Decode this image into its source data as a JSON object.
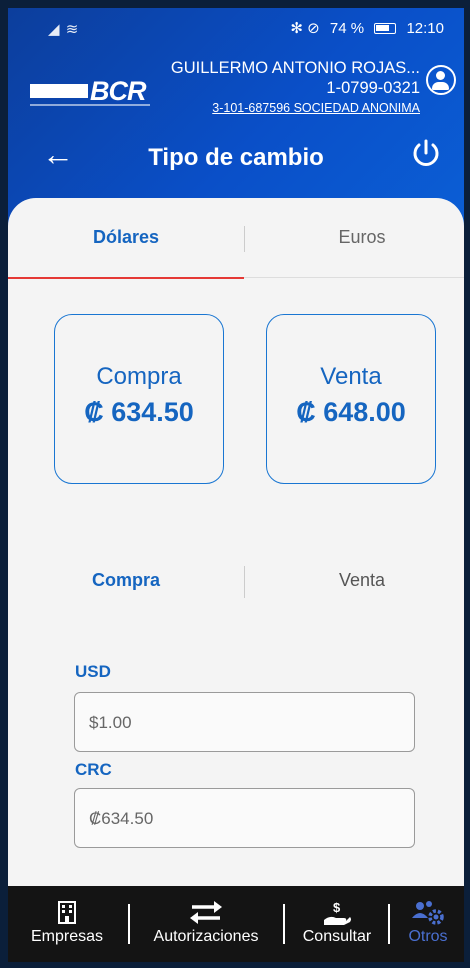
{
  "status": {
    "left": "◢ ≋",
    "right_icons": "✻ ⊘",
    "battery": "74 %",
    "time": "12:10"
  },
  "brand": {
    "logo_text": "BCR"
  },
  "user": {
    "name": "GUILLERMO ANTONIO ROJAS...",
    "id": "1-0799-0321",
    "company": "3-101-687596 SOCIEDAD ANONIMA"
  },
  "header": {
    "title": "Tipo de cambio",
    "back_glyph": "←"
  },
  "tabs": [
    {
      "label": "Dólares",
      "active": true
    },
    {
      "label": "Euros",
      "active": false
    }
  ],
  "rates": {
    "buy": {
      "label": "Compra",
      "value": "₡ 634.50"
    },
    "sell": {
      "label": "Venta",
      "value": "₡ 648.00"
    }
  },
  "converter": {
    "tabs": [
      {
        "label": "Compra",
        "active": true
      },
      {
        "label": "Venta",
        "active": false
      }
    ],
    "from_label": "USD",
    "from_value": "$1.00",
    "to_label": "CRC",
    "to_value": "₡634.50"
  },
  "bottom_nav": [
    {
      "label": "Empresas",
      "icon": "building-icon"
    },
    {
      "label": "Autorizaciones",
      "icon": "transfer-arrows-icon"
    },
    {
      "label": "Consultar",
      "icon": "hand-money-icon"
    },
    {
      "label": "Otros",
      "icon": "people-gear-icon",
      "active": true
    }
  ],
  "colors": {
    "header_blue": "#0a4fc8",
    "accent_blue": "#1565c0",
    "tab_underline": "#e53935",
    "nav_bg": "#141414",
    "nav_active": "#4a6fd0"
  }
}
